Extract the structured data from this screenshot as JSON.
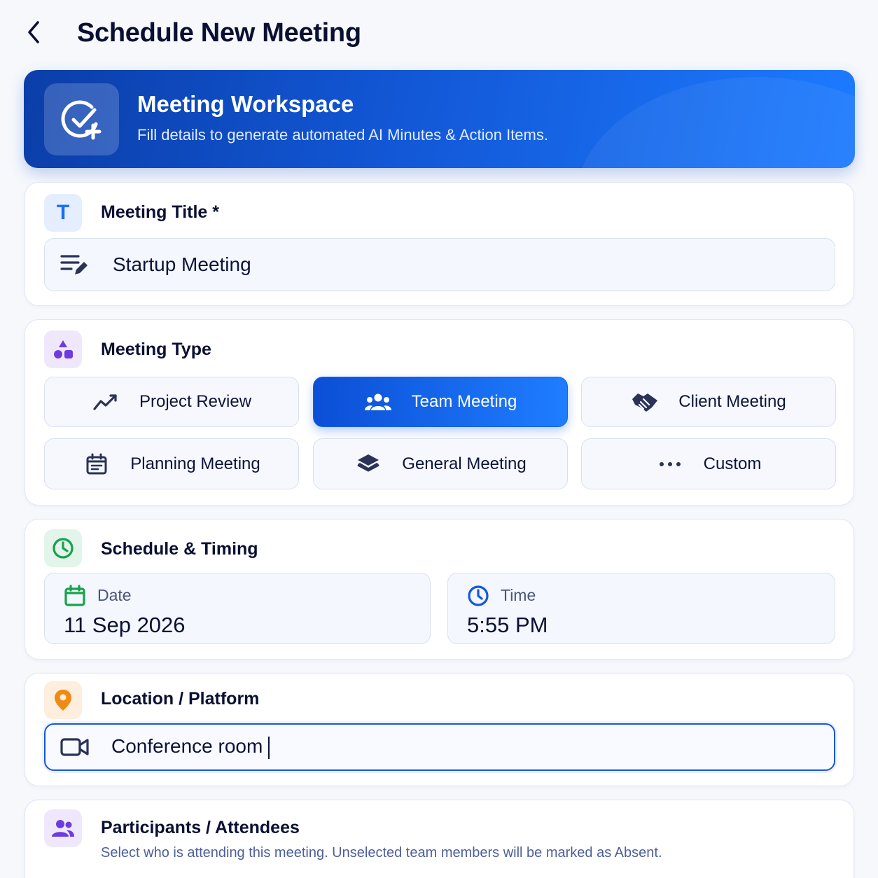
{
  "header": {
    "title": "Schedule New Meeting",
    "back_icon": "chevron-left-icon"
  },
  "banner": {
    "title": "Meeting Workspace",
    "subtitle": "Fill details to generate automated AI Minutes & Action Items.",
    "icon": "check-circle-plus-icon"
  },
  "meeting_title": {
    "label": "Meeting Title *",
    "icon_letter": "T",
    "value": "Startup Meeting",
    "field_icon": "edit-notes-icon"
  },
  "meeting_type": {
    "label": "Meeting Type",
    "selected": "Team Meeting",
    "options": [
      {
        "label": "Project Review",
        "icon": "trend-chart-icon"
      },
      {
        "label": "Team Meeting",
        "icon": "group-icon"
      },
      {
        "label": "Client Meeting",
        "icon": "handshake-icon"
      },
      {
        "label": "Planning Meeting",
        "icon": "calendar-icon"
      },
      {
        "label": "General Meeting",
        "icon": "layers-icon"
      },
      {
        "label": "Custom",
        "icon": "more-dots-icon"
      }
    ]
  },
  "schedule": {
    "label": "Schedule & Timing",
    "date_label": "Date",
    "date_value": "11 Sep 2026",
    "time_label": "Time",
    "time_value": "5:55 PM"
  },
  "location": {
    "label": "Location / Platform",
    "value": "Conference room",
    "field_icon": "video-camera-icon"
  },
  "participants": {
    "label": "Participants / Attendees",
    "description": "Select who is attending this meeting. Unselected team members will be marked as Absent."
  },
  "colors": {
    "accent": "#1562e6",
    "banner_start": "#0b3ea8",
    "banner_end": "#1d7bff",
    "green": "#16a34a",
    "orange": "#f08a12",
    "purple": "#6d3ce0"
  }
}
